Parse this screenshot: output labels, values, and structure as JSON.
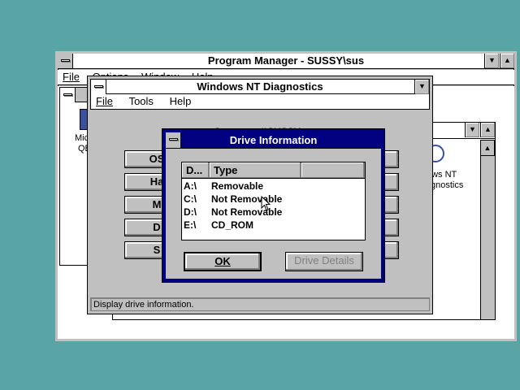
{
  "program_manager": {
    "title": "Program Manager - SUSSY\\sus",
    "menu": [
      "File",
      "Options",
      "Window",
      "Help"
    ]
  },
  "ntd": {
    "title": "Windows NT Diagnostics",
    "menu": [
      "File",
      "Tools",
      "Help"
    ],
    "computer_label": "Computer: \\\\SUSSY",
    "buttons": [
      "OS",
      "Ha",
      "M",
      "D",
      "S"
    ],
    "status": "Display drive information."
  },
  "group_icon": {
    "label_1": "Mic",
    "label_2": "QB"
  },
  "right_group": {
    "label_1": "ows NT",
    "label_2": "gnostics"
  },
  "drive_dialog": {
    "title": "Drive Information",
    "columns": [
      "D...",
      "Type"
    ],
    "rows": [
      {
        "drive": "A:\\",
        "type": "Removable"
      },
      {
        "drive": "C:\\",
        "type": "Not Removable"
      },
      {
        "drive": "D:\\",
        "type": "Not Removable"
      },
      {
        "drive": "E:\\",
        "type": "CD_ROM"
      }
    ],
    "ok_label": "OK",
    "details_label": "Drive Details"
  },
  "colors": {
    "desktop": "#59a5a5",
    "active_title": "#000080",
    "face": "#c0c0c0"
  }
}
